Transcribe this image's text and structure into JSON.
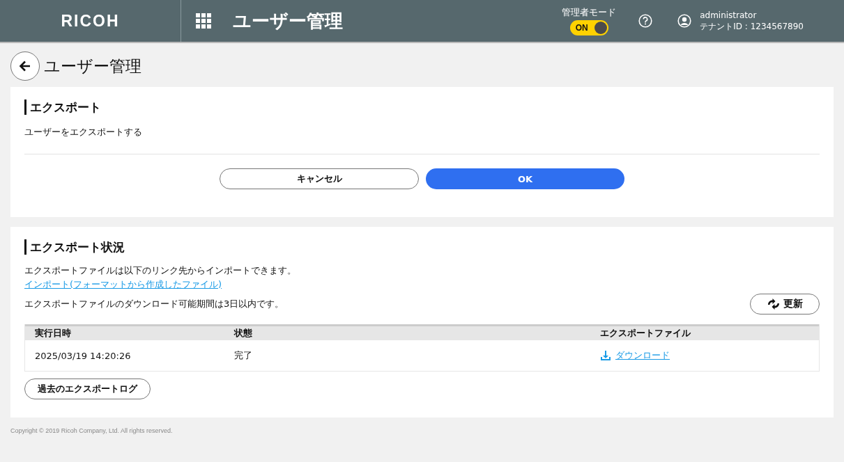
{
  "header": {
    "logo": "RICOH",
    "title": "ユーザー管理",
    "admin_mode": {
      "label": "管理者モード",
      "toggle_text": "ON",
      "on": true
    },
    "user": {
      "name": "administrator",
      "tenant": "テナントID : 1234567890"
    }
  },
  "page_title": "ユーザー管理",
  "export_card": {
    "title": "エクスポート",
    "description": "ユーザーをエクスポートする",
    "buttons": [
      {
        "label": "キャンセル",
        "kind": "secondary"
      },
      {
        "label": "OK",
        "kind": "primary"
      }
    ]
  },
  "status_card": {
    "title": "エクスポート状況",
    "note": "エクスポートファイルは以下のリンク先からインポートできます。",
    "link": "インポート(フォーマットから作成したファイル)",
    "period_note": "エクスポートファイルのダウンロード可能期間は3日以内です。",
    "refresh_button": "更新",
    "table": {
      "columns": [
        "実行日時",
        "状態",
        "エクスポートファイル"
      ],
      "rows": [
        {
          "date": "2025/03/19 14:20:26",
          "status": "完了",
          "file": "ダウンロード"
        }
      ]
    },
    "log_button": "過去のエクスポートログ"
  },
  "footer": "Copyright © 2019 Ricoh Company, Ltd. All rights reserved."
}
